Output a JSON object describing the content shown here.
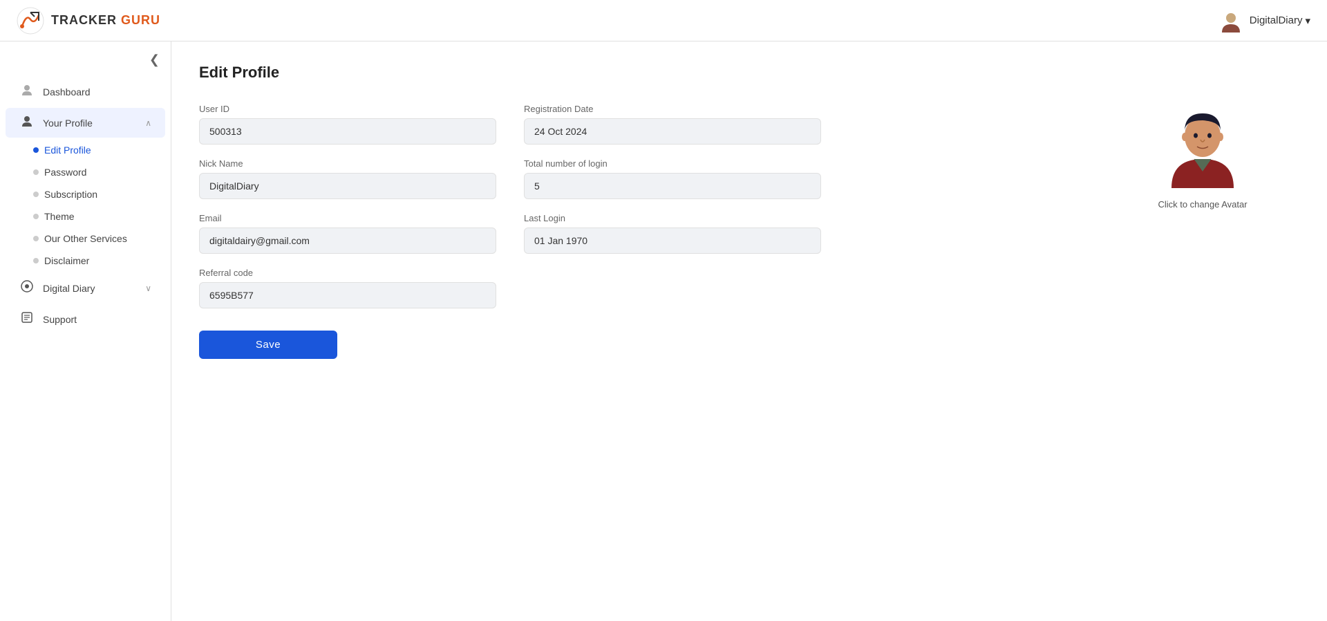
{
  "app": {
    "name": "TRACKER GURU",
    "tracker": "TRACKER",
    "guru": "GURU"
  },
  "header": {
    "user_name": "DigitalDiary",
    "user_dropdown": "DigitalDiary ▾"
  },
  "sidebar": {
    "collapse_icon": "❮",
    "items": [
      {
        "id": "dashboard",
        "label": "Dashboard",
        "icon": "👤",
        "active": false
      },
      {
        "id": "your-profile",
        "label": "Your Profile",
        "icon": "👤",
        "active": true,
        "expanded": true,
        "children": [
          {
            "id": "edit-profile",
            "label": "Edit Profile",
            "active": true
          },
          {
            "id": "password",
            "label": "Password",
            "active": false
          },
          {
            "id": "subscription",
            "label": "Subscription",
            "active": false
          },
          {
            "id": "theme",
            "label": "Theme",
            "active": false
          },
          {
            "id": "other-services",
            "label": "Our Other Services",
            "active": false
          },
          {
            "id": "disclaimer",
            "label": "Disclaimer",
            "active": false
          }
        ]
      },
      {
        "id": "digital-diary",
        "label": "Digital Diary",
        "icon": "💿",
        "active": false,
        "expandable": true
      },
      {
        "id": "support",
        "label": "Support",
        "icon": "📋",
        "active": false
      }
    ]
  },
  "page": {
    "title": "Edit Profile"
  },
  "form": {
    "user_id_label": "User ID",
    "user_id_value": "500313",
    "registration_date_label": "Registration Date",
    "registration_date_value": "24 Oct 2024",
    "nick_name_label": "Nick Name",
    "nick_name_value": "DigitalDiary",
    "total_logins_label": "Total number of login",
    "total_logins_value": "5",
    "email_label": "Email",
    "email_value": "digitaldairy@gmail.com",
    "last_login_label": "Last Login",
    "last_login_value": "01 Jan 1970",
    "referral_code_label": "Referral code",
    "referral_code_value": "6595B577",
    "save_label": "Save"
  },
  "avatar": {
    "caption": "Click to change Avatar"
  },
  "colors": {
    "accent": "#1a56db",
    "orange": "#e05a1c"
  }
}
